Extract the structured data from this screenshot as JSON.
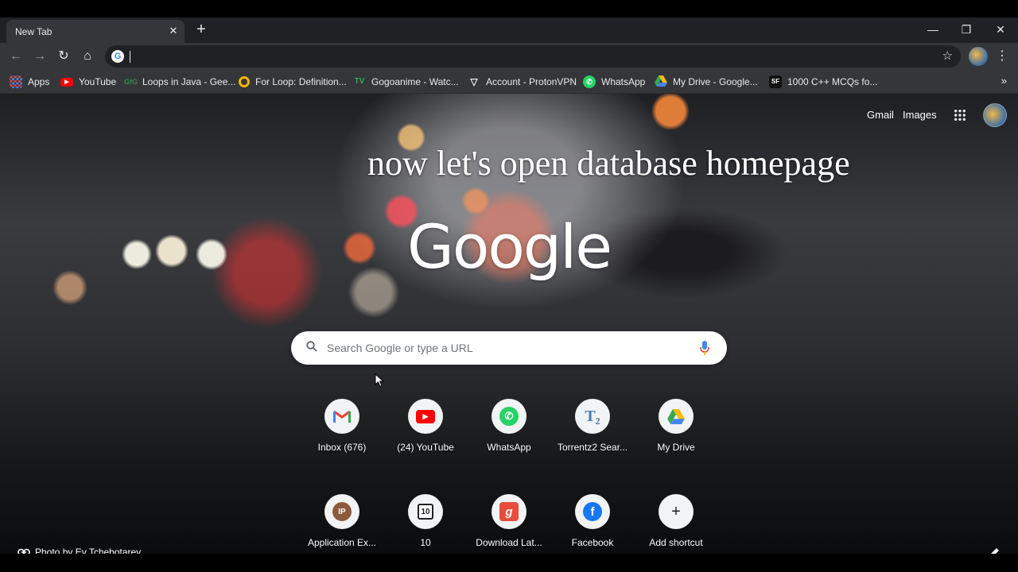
{
  "tab": {
    "title": "New Tab",
    "close": "✕",
    "new_tab": "+"
  },
  "window_controls": {
    "minimize": "—",
    "restore": "❐",
    "close": "✕"
  },
  "toolbar": {
    "back": "←",
    "forward": "→",
    "reload": "↻",
    "home": "⌂",
    "omnibox_value": "",
    "bookmark_star": "☆",
    "menu": "⋮"
  },
  "bookmarks": {
    "items": [
      {
        "label": "Apps",
        "icon": "apps-grid-icon",
        "color": "#ea4335"
      },
      {
        "label": "YouTube",
        "icon": "youtube-icon",
        "color": "#ff0000"
      },
      {
        "label": "Loops in Java - Gee...",
        "icon": "geeksforgeeks-icon",
        "color": "#2f8d46"
      },
      {
        "label": "For Loop: Definition...",
        "icon": "ring-icon",
        "color": "#f4b400"
      },
      {
        "label": "Gogoanime - Watc...",
        "icon": "gogoanime-icon",
        "color": "#1e8e3e"
      },
      {
        "label": "Account - ProtonVPN",
        "icon": "protonvpn-icon",
        "color": "#e8eaed"
      },
      {
        "label": "WhatsApp",
        "icon": "whatsapp-icon",
        "color": "#25d366"
      },
      {
        "label": "My Drive - Google...",
        "icon": "drive-icon",
        "color": "#fbbc04"
      },
      {
        "label": "1000 C++ MCQs fo...",
        "icon": "sanfoundry-icon",
        "color": "#1a1a1a"
      }
    ],
    "more": "»"
  },
  "ntp": {
    "gmail": "Gmail",
    "images": "Images",
    "overlay_caption": "now let's open database homepage",
    "logo": "Google",
    "search_placeholder": "Search Google or type a URL",
    "shortcuts": [
      {
        "label": "Inbox (676)",
        "icon": "gmail-icon",
        "glyph": "M",
        "color": "#ea4335"
      },
      {
        "label": "(24) YouTube",
        "icon": "youtube-icon",
        "glyph": "▶",
        "color": "#ff0000"
      },
      {
        "label": "WhatsApp",
        "icon": "whatsapp-icon",
        "glyph": "✆",
        "color": "#25d366"
      },
      {
        "label": "Torrentz2 Sear...",
        "icon": "torrentz2-icon",
        "glyph": "T₂",
        "color": "#4a7fb5"
      },
      {
        "label": "My Drive",
        "icon": "drive-icon",
        "glyph": "▲",
        "color": "#fbbc04"
      },
      {
        "label": "Application Ex...",
        "icon": "ip-icon",
        "glyph": "IP",
        "color": "#8d5a3b"
      },
      {
        "label": "10",
        "icon": "ten-icon",
        "glyph": "10",
        "color": "#ffffff"
      },
      {
        "label": "Download Lat...",
        "icon": "g-tile-icon",
        "glyph": "g",
        "color": "#e74c3c"
      },
      {
        "label": "Facebook",
        "icon": "facebook-icon",
        "glyph": "f",
        "color": "#1877f2"
      },
      {
        "label": "Add shortcut",
        "icon": "plus-icon",
        "glyph": "+",
        "color": "#202124"
      }
    ],
    "attribution": "Photo by Ev Tchebotarev"
  }
}
